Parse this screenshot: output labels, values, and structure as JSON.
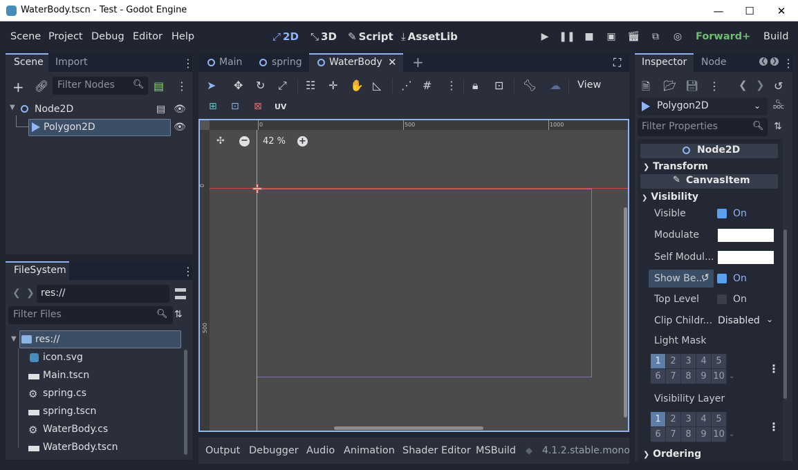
{
  "window": {
    "title": "WaterBody.tscn - Test - Godot Engine",
    "minimize": "—",
    "maximize": "☐",
    "close": "✕"
  },
  "menu": [
    "Scene",
    "Project",
    "Debug",
    "Editor",
    "Help"
  ],
  "modes": {
    "m2d": "2D",
    "m3d": "3D",
    "script": "Script",
    "assetlib": "AssetLib"
  },
  "renderer": "Forward+",
  "build": "Build",
  "scene_dock": {
    "tabs": [
      "Scene",
      "Import"
    ],
    "filter_placeholder": "Filter Nodes",
    "nodes": [
      "Node2D",
      "Polygon2D"
    ]
  },
  "filesystem": {
    "tab": "FileSystem",
    "path": "res://",
    "filter_placeholder": "Filter Files",
    "root": "res://",
    "files": [
      "icon.svg",
      "Main.tscn",
      "spring.cs",
      "spring.tscn",
      "WaterBody.cs",
      "WaterBody.tscn"
    ]
  },
  "editor_tabs": [
    "Main",
    "spring",
    "WaterBody"
  ],
  "toolbar": {
    "view": "View",
    "uv": "UV"
  },
  "viewport": {
    "zoom": "42 %",
    "ruler_top": [
      "0",
      "500",
      "1000"
    ],
    "ruler_left": [
      "0",
      "500"
    ]
  },
  "bottom_tabs": [
    "Output",
    "Debugger",
    "Audio",
    "Animation",
    "Shader Editor",
    "MSBuild"
  ],
  "version": "4.1.2.stable.mono",
  "inspector": {
    "tabs": [
      "Inspector",
      "Node"
    ],
    "object": "Polygon2D",
    "filter_placeholder": "Filter Properties",
    "class_node2d": "Node2D",
    "transform": "Transform",
    "class_canvasitem": "CanvasItem",
    "visibility": "Visibility",
    "visible_label": "Visible",
    "visible_val": "On",
    "modulate_label": "Modulate",
    "self_modulate_label": "Self Modul...",
    "show_behind_label": "Show Be...",
    "show_behind_val": "On",
    "top_level_label": "Top Level",
    "top_level_val": "On",
    "clip_children_label": "Clip Childr...",
    "clip_children_val": "Disabled",
    "light_mask_label": "Light Mask",
    "visibility_layer_label": "Visibility Layer",
    "layers_row1": [
      "1",
      "2",
      "3",
      "4",
      "5"
    ],
    "layers_row2": [
      "6",
      "7",
      "8",
      "9",
      "10"
    ],
    "ordering": "Ordering",
    "doc": "DOC"
  },
  "colors": {
    "accent": "#8fb4f5",
    "bg": "#202531",
    "panel": "#2a2f3b",
    "viewport": "#4b4b4b"
  }
}
